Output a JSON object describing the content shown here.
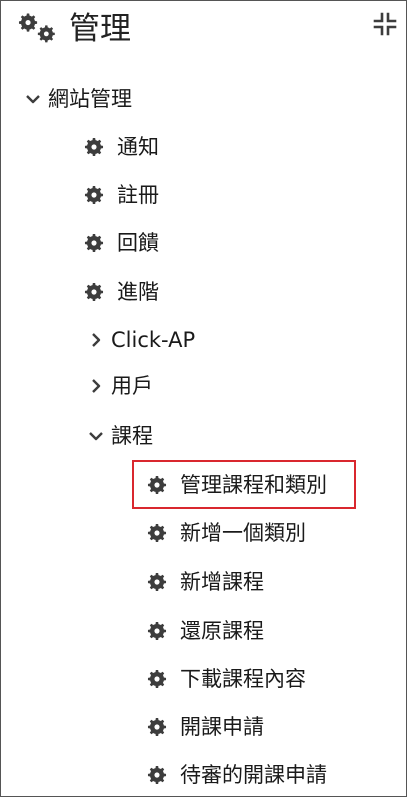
{
  "header": {
    "title": "管理",
    "icon": "gears-icon",
    "collapse_icon": "collapse-arrows-icon"
  },
  "tree": {
    "site_admin": {
      "label": "網站管理",
      "expanded": true
    },
    "items": [
      {
        "label": "通知",
        "icon": "gear-icon"
      },
      {
        "label": "註冊",
        "icon": "gear-icon"
      },
      {
        "label": "回饋",
        "icon": "gear-icon"
      },
      {
        "label": "進階",
        "icon": "gear-icon"
      }
    ],
    "collapsed": [
      {
        "label": "Click-AP",
        "icon": "chevron-right-icon"
      },
      {
        "label": "用戶",
        "icon": "chevron-right-icon"
      }
    ],
    "courses": {
      "label": "課程",
      "expanded": true,
      "items": [
        {
          "label": "管理課程和類別",
          "icon": "gear-icon",
          "highlighted": true
        },
        {
          "label": "新增一個類別",
          "icon": "gear-icon"
        },
        {
          "label": "新增課程",
          "icon": "gear-icon"
        },
        {
          "label": "還原課程",
          "icon": "gear-icon"
        },
        {
          "label": "下載課程內容",
          "icon": "gear-icon"
        },
        {
          "label": "開課申請",
          "icon": "gear-icon"
        },
        {
          "label": "待審的開課申請",
          "icon": "gear-icon"
        }
      ]
    }
  },
  "colors": {
    "icon": "#3d3d3d",
    "highlight_border": "#d9272e",
    "frame_border": "#555555"
  }
}
